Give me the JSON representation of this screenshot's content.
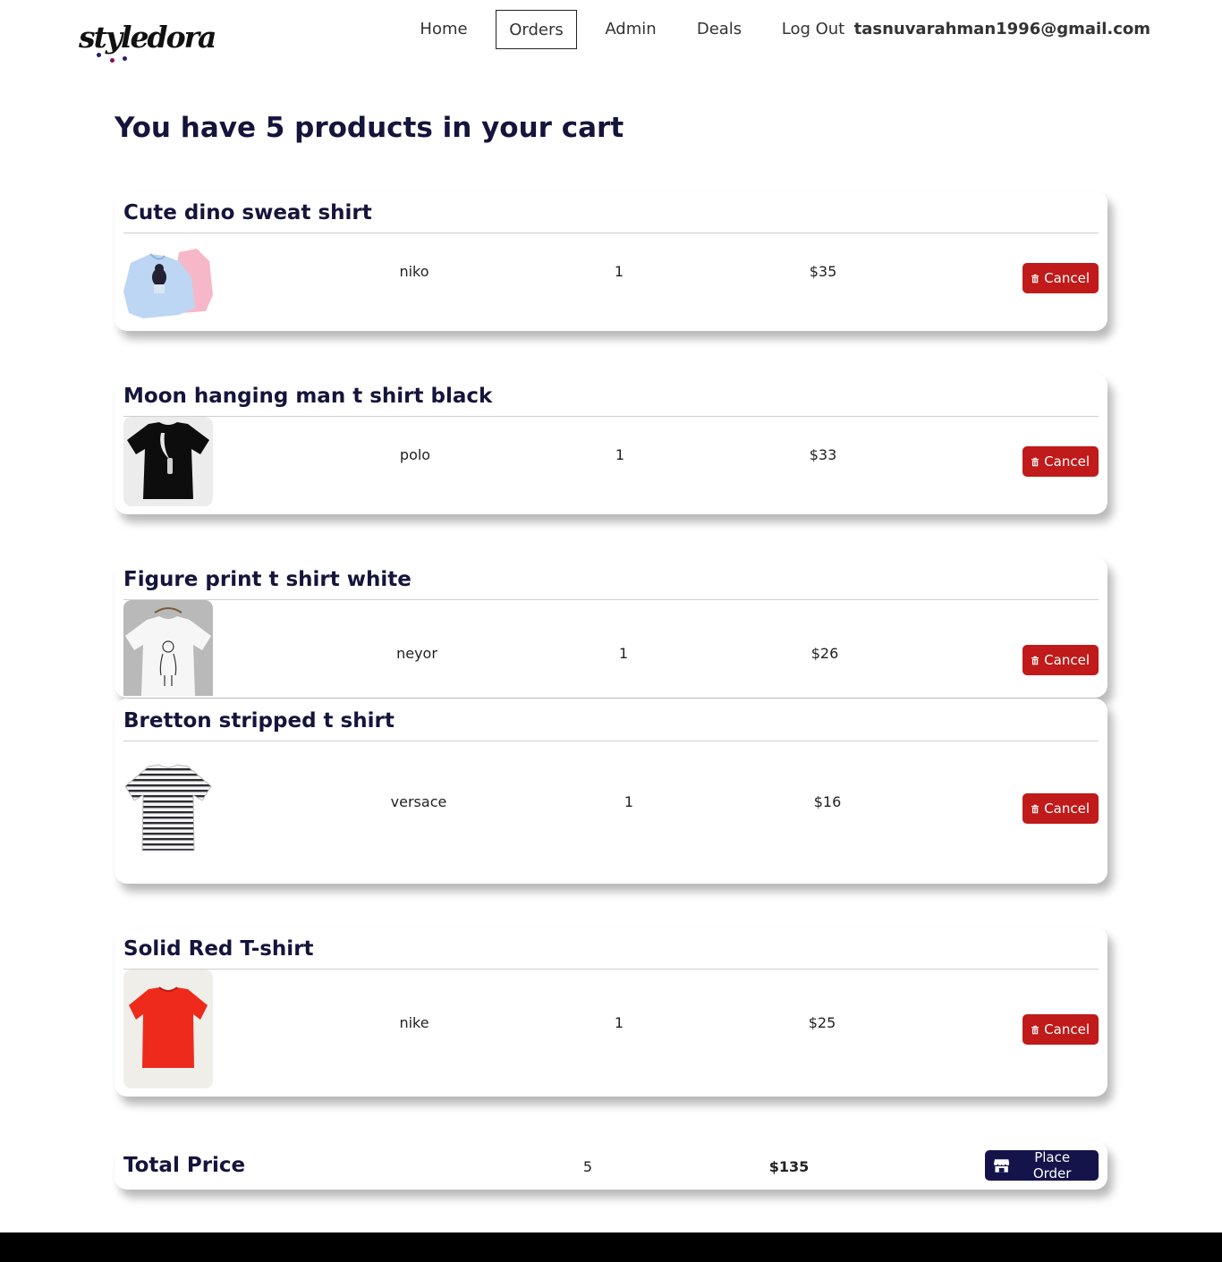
{
  "brand": {
    "logo_text": "styledora"
  },
  "nav": {
    "items": [
      {
        "label": "Home",
        "active": false
      },
      {
        "label": "Orders",
        "active": true
      },
      {
        "label": "Admin",
        "active": false
      },
      {
        "label": "Deals",
        "active": false
      },
      {
        "label": "Log Out",
        "active": false
      }
    ],
    "user_email": "tasnuvarahman1996@gmail.com"
  },
  "cart": {
    "heading": "You have 5 products in your cart",
    "cancel_label": "Cancel",
    "items": [
      {
        "name": "Cute dino sweat shirt",
        "brand": "niko",
        "quantity": "1",
        "price": "$35",
        "image": "sweatshirt-image"
      },
      {
        "name": "Moon hanging man t shirt black",
        "brand": "polo",
        "quantity": "1",
        "price": "$33",
        "image": "black-tshirt-image"
      },
      {
        "name": "Figure print t shirt white",
        "brand": "neyor",
        "quantity": "1",
        "price": "$26",
        "image": "white-tshirt-image"
      },
      {
        "name": "Bretton stripped t shirt",
        "brand": "versace",
        "quantity": "1",
        "price": "$16",
        "image": "striped-tshirt-image"
      },
      {
        "name": "Solid Red T-shirt",
        "brand": "nike",
        "quantity": "1",
        "price": "$25",
        "image": "red-tshirt-image"
      }
    ]
  },
  "summary": {
    "label": "Total Price",
    "total_quantity": "5",
    "total_price": "$135",
    "place_order_label": "Place Order"
  },
  "colors": {
    "primary_navy": "#14143c",
    "cancel_red": "#c01a1a",
    "order_button": "#14144a"
  }
}
